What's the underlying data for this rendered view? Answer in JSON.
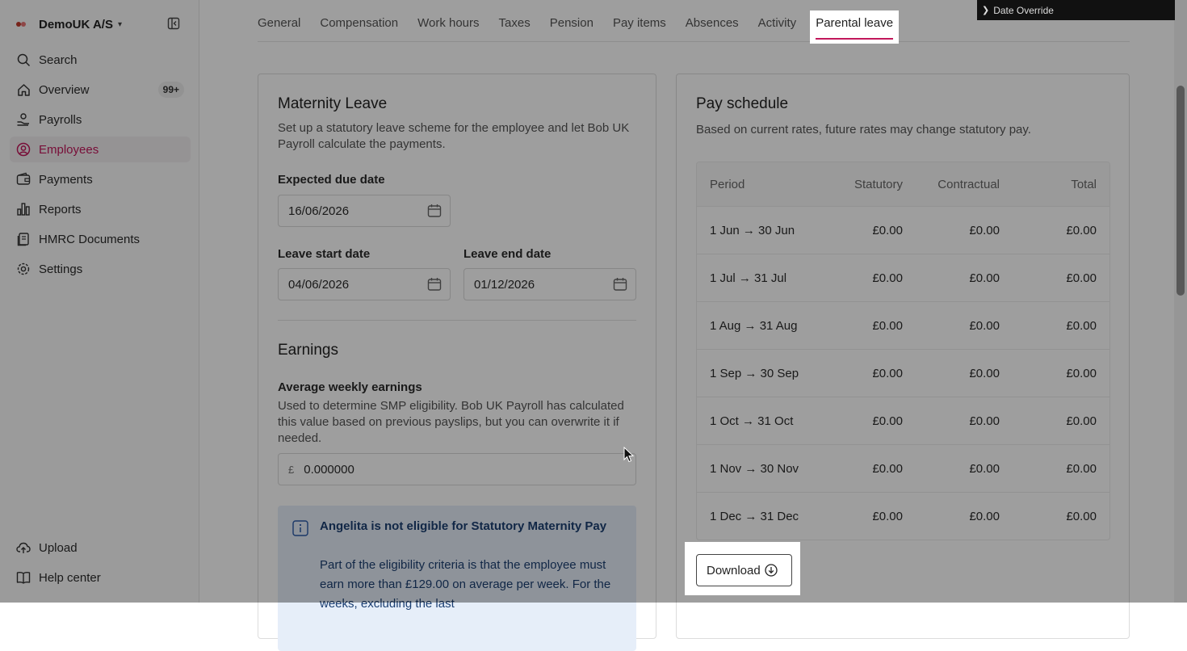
{
  "sidebar": {
    "company": "DemoUK A/S",
    "items": [
      {
        "label": "Search",
        "icon": "search-icon"
      },
      {
        "label": "Overview",
        "icon": "home-icon",
        "badge": "99+"
      },
      {
        "label": "Payrolls",
        "icon": "payroll-hand-icon"
      },
      {
        "label": "Employees",
        "icon": "user-circle-icon",
        "active": true
      },
      {
        "label": "Payments",
        "icon": "wallet-icon"
      },
      {
        "label": "Reports",
        "icon": "bar-chart-icon"
      },
      {
        "label": "HMRC Documents",
        "icon": "documents-icon"
      },
      {
        "label": "Settings",
        "icon": "gear-icon"
      }
    ],
    "bottom": [
      {
        "label": "Upload",
        "icon": "cloud-upload-icon"
      },
      {
        "label": "Help center",
        "icon": "book-icon"
      }
    ]
  },
  "tabs": [
    "General",
    "Compensation",
    "Work hours",
    "Taxes",
    "Pension",
    "Pay items",
    "Absences",
    "Activity",
    "Parental leave"
  ],
  "active_tab": "Parental leave",
  "date_override": "Date Override",
  "maternity": {
    "title": "Maternity Leave",
    "description": "Set up a statutory leave scheme for the employee and let Bob UK Payroll calculate the payments.",
    "due_date_label": "Expected due date",
    "due_date": "16/06/2026",
    "start_label": "Leave start date",
    "start_date": "04/06/2026",
    "end_label": "Leave end date",
    "end_date": "01/12/2026",
    "earnings_title": "Earnings",
    "awe_label": "Average weekly earnings",
    "awe_description": "Used to determine SMP eligibility. Bob UK Payroll has calculated this value based on previous payslips, but you can overwrite it if needed.",
    "currency_symbol": "£",
    "awe_value": "0.000000",
    "alert_title": "Angelita is not eligible for Statutory Maternity Pay",
    "alert_text": "Part of the eligibility criteria is that the employee must earn more than £129.00 on average per week. For the weeks, excluding the last"
  },
  "pay_schedule": {
    "title": "Pay schedule",
    "subtitle": "Based on current rates, future rates may change statutory pay.",
    "columns": [
      "Period",
      "Statutory",
      "Contractual",
      "Total"
    ],
    "rows": [
      [
        "1 Jun → 30 Jun",
        "£0.00",
        "£0.00",
        "£0.00"
      ],
      [
        "1 Jul → 31 Jul",
        "£0.00",
        "£0.00",
        "£0.00"
      ],
      [
        "1 Aug → 31 Aug",
        "£0.00",
        "£0.00",
        "£0.00"
      ],
      [
        "1 Sep → 30 Sep",
        "£0.00",
        "£0.00",
        "£0.00"
      ],
      [
        "1 Oct → 31 Oct",
        "£0.00",
        "£0.00",
        "£0.00"
      ],
      [
        "1 Nov → 30 Nov",
        "£0.00",
        "£0.00",
        "£0.00"
      ],
      [
        "1 Dec → 31 Dec",
        "£0.00",
        "£0.00",
        "£0.00"
      ]
    ],
    "download_label": "Download"
  },
  "colors": {
    "accent": "#c2185b",
    "info_bg": "#e6eef9",
    "info_text": "#1c3f72"
  }
}
